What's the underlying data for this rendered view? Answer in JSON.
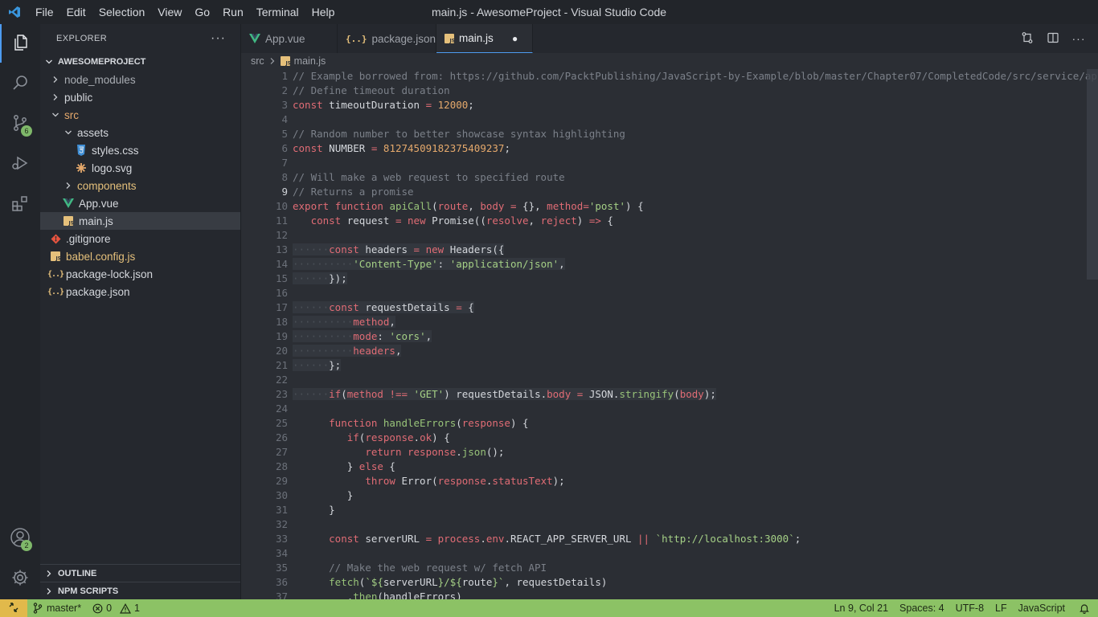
{
  "window_title": "main.js - AwesomeProject - Visual Studio Code",
  "menu": [
    "File",
    "Edit",
    "Selection",
    "View",
    "Go",
    "Run",
    "Terminal",
    "Help"
  ],
  "activity": {
    "source_control_badge": "6",
    "accounts_badge": "2"
  },
  "explorer": {
    "title": "EXPLORER",
    "more": "···",
    "project": "AWESOMEPROJECT",
    "items": [
      {
        "label": "node_modules",
        "depth": 0,
        "type": "folder",
        "open": false,
        "color": "#a9adb3",
        "icon": "chevron-right"
      },
      {
        "label": "public",
        "depth": 0,
        "type": "folder",
        "open": false,
        "color": "#d4d7dc",
        "icon": "chevron-right"
      },
      {
        "label": "src",
        "depth": 0,
        "type": "folder",
        "open": true,
        "color": "#e5a96c",
        "icon": "chevron-down"
      },
      {
        "label": "assets",
        "depth": 1,
        "type": "folder",
        "open": true,
        "color": "#d4d7dc",
        "icon": "chevron-down"
      },
      {
        "label": "styles.css",
        "depth": 2,
        "type": "css",
        "color": "#d4d7dc",
        "icon": "css-file"
      },
      {
        "label": "logo.svg",
        "depth": 2,
        "type": "svg",
        "color": "#d4d7dc",
        "icon": "svg-file"
      },
      {
        "label": "components",
        "depth": 1,
        "type": "folder",
        "open": false,
        "color": "#e5c07b",
        "icon": "chevron-right"
      },
      {
        "label": "App.vue",
        "depth": 1,
        "type": "vue",
        "color": "#d4d7dc",
        "icon": "vue-file"
      },
      {
        "label": "main.js",
        "depth": 1,
        "type": "js",
        "color": "#d4d7dc",
        "icon": "js-file",
        "selected": true
      },
      {
        "label": ".gitignore",
        "depth": 0,
        "type": "git",
        "color": "#d4d7dc",
        "icon": "git-file"
      },
      {
        "label": "babel.config.js",
        "depth": 0,
        "type": "js",
        "color": "#e5c07b",
        "icon": "js-file"
      },
      {
        "label": "package-lock.json",
        "depth": 0,
        "type": "json",
        "color": "#d4d7dc",
        "icon": "json-file"
      },
      {
        "label": "package.json",
        "depth": 0,
        "type": "json",
        "color": "#d4d7dc",
        "icon": "json-file"
      }
    ],
    "outline": "OUTLINE",
    "npm_scripts": "NPM SCRIPTS"
  },
  "tabs": [
    {
      "label": "App.vue",
      "icon": "vue-file"
    },
    {
      "label": "package.json",
      "icon": "json-file"
    },
    {
      "label": "main.js",
      "icon": "js-file",
      "active": true,
      "dirty": "●"
    }
  ],
  "breadcrumb": [
    "src",
    "main.js"
  ],
  "colors": {
    "comment": "#7b8089",
    "keyword": "#e06c75",
    "function": "#98c379",
    "string": "#a5d086",
    "number": "#e5a96c",
    "param": "#e06c75",
    "plain": "#d4d7dc",
    "accent": "#4d9bf0",
    "status": "#8cc265"
  },
  "editor": {
    "current_line": 9,
    "lines": [
      [
        [
          "c",
          "// Example borrowed from: https://github.com/PacktPublishing/JavaScript-by-Example/blob/master/Chapter07/CompletedCode/src/service/api/apiCall.js"
        ]
      ],
      [
        [
          "c",
          "// Define timeout duration"
        ]
      ],
      [
        [
          "k",
          "const"
        ],
        [
          "p",
          " timeoutDuration "
        ],
        [
          "k",
          "="
        ],
        [
          "p",
          " "
        ],
        [
          "n",
          "12000"
        ],
        [
          "p",
          ";"
        ]
      ],
      [],
      [
        [
          "c",
          "// Random number to better showcase syntax highlighting"
        ]
      ],
      [
        [
          "k",
          "const"
        ],
        [
          "p",
          " NUMBER "
        ],
        [
          "k",
          "="
        ],
        [
          "p",
          " "
        ],
        [
          "n",
          "812745091823754092​37"
        ],
        [
          "p",
          ";"
        ]
      ],
      [],
      [
        [
          "c",
          "// Will make a web request to specified route"
        ]
      ],
      [
        [
          "c",
          "// Returns a promise"
        ]
      ],
      [
        [
          "k",
          "export"
        ],
        [
          "p",
          " "
        ],
        [
          "k",
          "function"
        ],
        [
          "p",
          " "
        ],
        [
          "f",
          "apiCall"
        ],
        [
          "p",
          "("
        ],
        [
          "a",
          "route"
        ],
        [
          "p",
          ", "
        ],
        [
          "a",
          "body"
        ],
        [
          "p",
          " "
        ],
        [
          "k",
          "="
        ],
        [
          "p",
          " {}, "
        ],
        [
          "a",
          "method"
        ],
        [
          "k",
          "="
        ],
        [
          "s",
          "'post'"
        ],
        [
          "p",
          ") {"
        ]
      ],
      [
        [
          "p",
          "   "
        ],
        [
          "k",
          "const"
        ],
        [
          "p",
          " request "
        ],
        [
          "k",
          "="
        ],
        [
          "p",
          " "
        ],
        [
          "k",
          "new"
        ],
        [
          "p",
          " Promise(("
        ],
        [
          "a",
          "resolve"
        ],
        [
          "p",
          ", "
        ],
        [
          "a",
          "reject"
        ],
        [
          "p",
          ") "
        ],
        [
          "k",
          "=>"
        ],
        [
          "p",
          " {"
        ]
      ],
      [],
      [
        [
          "g",
          "······"
        ],
        [
          "k",
          "const"
        ],
        [
          "p",
          " headers "
        ],
        [
          "k",
          "="
        ],
        [
          "p",
          " "
        ],
        [
          "k",
          "new"
        ],
        [
          "p",
          " Headers({"
        ]
      ],
      [
        [
          "g",
          "··········"
        ],
        [
          "s",
          "'Content-Type'"
        ],
        [
          "p",
          ": "
        ],
        [
          "s",
          "'application/json'"
        ],
        [
          "p",
          ","
        ]
      ],
      [
        [
          "g",
          "······"
        ],
        [
          "p",
          "});"
        ]
      ],
      [],
      [
        [
          "g",
          "······"
        ],
        [
          "k",
          "const"
        ],
        [
          "p",
          " requestDetails "
        ],
        [
          "k",
          "="
        ],
        [
          "p",
          " {"
        ]
      ],
      [
        [
          "g",
          "··········"
        ],
        [
          "a",
          "method"
        ],
        [
          "p",
          ","
        ]
      ],
      [
        [
          "g",
          "··········"
        ],
        [
          "a",
          "mode"
        ],
        [
          "p",
          ": "
        ],
        [
          "s",
          "'cors'"
        ],
        [
          "p",
          ","
        ]
      ],
      [
        [
          "g",
          "··········"
        ],
        [
          "a",
          "headers"
        ],
        [
          "p",
          ","
        ]
      ],
      [
        [
          "g",
          "······"
        ],
        [
          "p",
          "};"
        ]
      ],
      [],
      [
        [
          "g",
          "······"
        ],
        [
          "k",
          "if"
        ],
        [
          "p",
          "("
        ],
        [
          "a",
          "method"
        ],
        [
          "p",
          " "
        ],
        [
          "k",
          "!=="
        ],
        [
          "p",
          " "
        ],
        [
          "s",
          "'GET'"
        ],
        [
          "p",
          ") requestDetails."
        ],
        [
          "a",
          "body"
        ],
        [
          "p",
          " "
        ],
        [
          "k",
          "="
        ],
        [
          "p",
          " JSON."
        ],
        [
          "f",
          "stringify"
        ],
        [
          "p",
          "("
        ],
        [
          "a",
          "body"
        ],
        [
          "p",
          ");"
        ]
      ],
      [],
      [
        [
          "p",
          "      "
        ],
        [
          "k",
          "function"
        ],
        [
          "p",
          " "
        ],
        [
          "f",
          "handleErrors"
        ],
        [
          "p",
          "("
        ],
        [
          "a",
          "response"
        ],
        [
          "p",
          ") {"
        ]
      ],
      [
        [
          "p",
          "         "
        ],
        [
          "k",
          "if"
        ],
        [
          "p",
          "("
        ],
        [
          "a",
          "response"
        ],
        [
          "p",
          "."
        ],
        [
          "a",
          "ok"
        ],
        [
          "p",
          ") {"
        ]
      ],
      [
        [
          "p",
          "            "
        ],
        [
          "k",
          "return"
        ],
        [
          "p",
          " "
        ],
        [
          "a",
          "response"
        ],
        [
          "p",
          "."
        ],
        [
          "f",
          "json"
        ],
        [
          "p",
          "();"
        ]
      ],
      [
        [
          "p",
          "         } "
        ],
        [
          "k",
          "else"
        ],
        [
          "p",
          " {"
        ]
      ],
      [
        [
          "p",
          "            "
        ],
        [
          "k",
          "throw"
        ],
        [
          "p",
          " Error("
        ],
        [
          "a",
          "response"
        ],
        [
          "p",
          "."
        ],
        [
          "a",
          "statusText"
        ],
        [
          "p",
          ");"
        ]
      ],
      [
        [
          "p",
          "         }"
        ]
      ],
      [
        [
          "p",
          "      }"
        ]
      ],
      [],
      [
        [
          "p",
          "      "
        ],
        [
          "k",
          "const"
        ],
        [
          "p",
          " serverURL "
        ],
        [
          "k",
          "="
        ],
        [
          "p",
          " "
        ],
        [
          "a",
          "process"
        ],
        [
          "p",
          "."
        ],
        [
          "a",
          "env"
        ],
        [
          "p",
          ".REACT_APP_SERVER_URL "
        ],
        [
          "k",
          "||"
        ],
        [
          "p",
          " "
        ],
        [
          "s",
          "`http://localhost:3000`"
        ],
        [
          "p",
          ";"
        ]
      ],
      [],
      [
        [
          "p",
          "      "
        ],
        [
          "c",
          "// Make the web request w/ fetch API"
        ]
      ],
      [
        [
          "p",
          "      "
        ],
        [
          "f",
          "fetch"
        ],
        [
          "p",
          "("
        ],
        [
          "s",
          "`${"
        ],
        [
          "p",
          "serverURL"
        ],
        [
          "s",
          "}/${"
        ],
        [
          "p",
          "route"
        ],
        [
          "s",
          "}`"
        ],
        [
          "p",
          ", requestDetails)"
        ]
      ],
      [
        [
          "p",
          "         ."
        ],
        [
          "f",
          "then"
        ],
        [
          "p",
          "(handleErrors)"
        ]
      ]
    ]
  },
  "status": {
    "branch": "master*",
    "errors": "0",
    "warnings": "1",
    "position": "Ln 9, Col 21",
    "spaces": "Spaces: 4",
    "encoding": "UTF-8",
    "eol": "LF",
    "language": "JavaScript"
  }
}
